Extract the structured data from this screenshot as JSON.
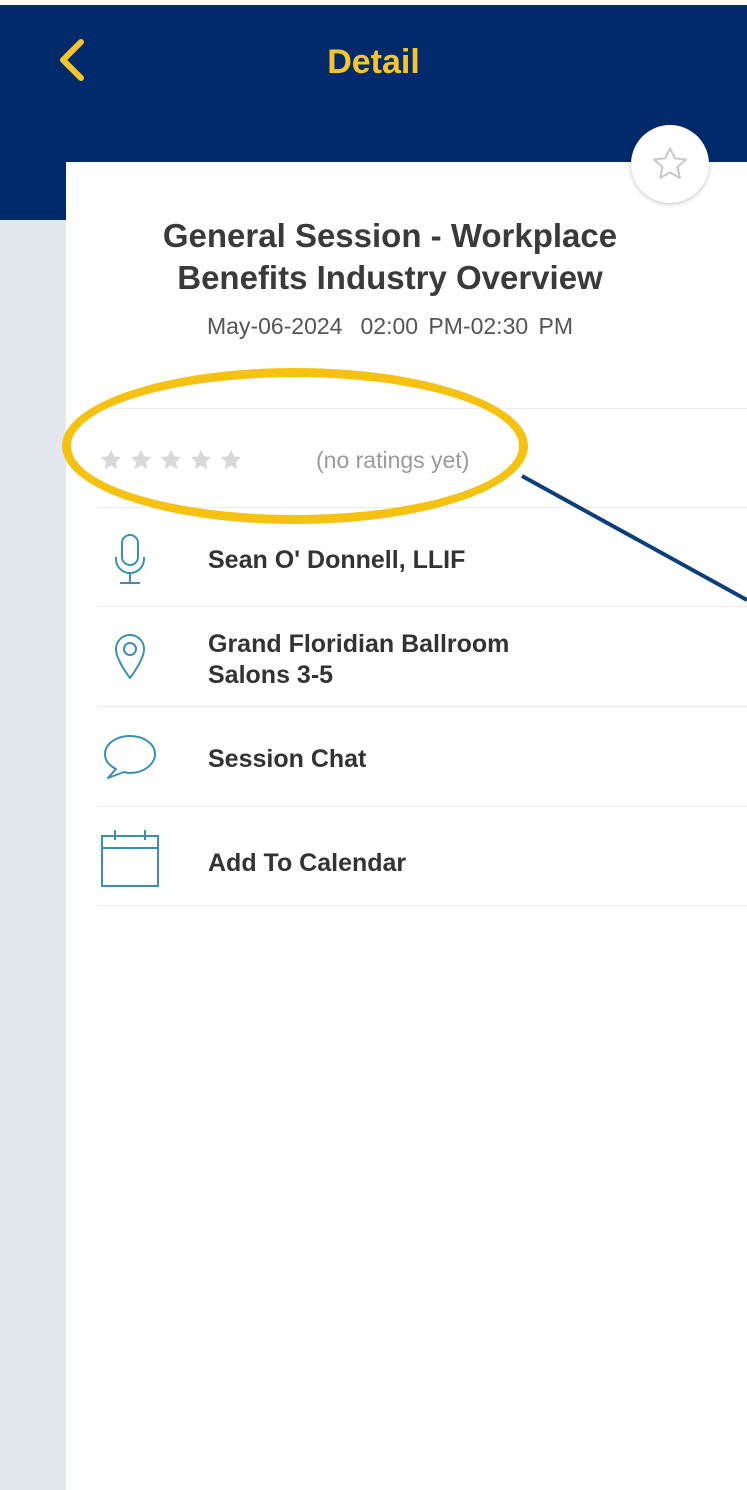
{
  "nav": {
    "title": "Detail",
    "back_icon": "chevron-left-icon"
  },
  "colors": {
    "nav_background": "#002a6c",
    "accent_yellow": "#f7c626",
    "icon_blue": "#3a8fb7",
    "highlight": "#f5c211",
    "pointer_line": "#0a3f7a"
  },
  "session": {
    "title_line1": "General Session - Workplace",
    "title_line2": "Benefits Industry Overview",
    "date": "May-06-2024",
    "time": "02:00 PM-02:30 PM",
    "favorite_icon": "star-outline-icon"
  },
  "rating": {
    "value": 0,
    "max": 5,
    "text": "(no ratings yet)"
  },
  "details": {
    "speaker": {
      "label": "Sean O' Donnell, LLIF",
      "icon": "microphone-icon"
    },
    "location": {
      "line1": "Grand Floridian Ballroom",
      "line2": "Salons 3-5",
      "icon": "map-pin-icon"
    },
    "chat": {
      "label": "Session Chat",
      "icon": "chat-bubble-icon"
    },
    "calendar": {
      "label": "Add To Calendar",
      "icon": "calendar-icon"
    }
  }
}
